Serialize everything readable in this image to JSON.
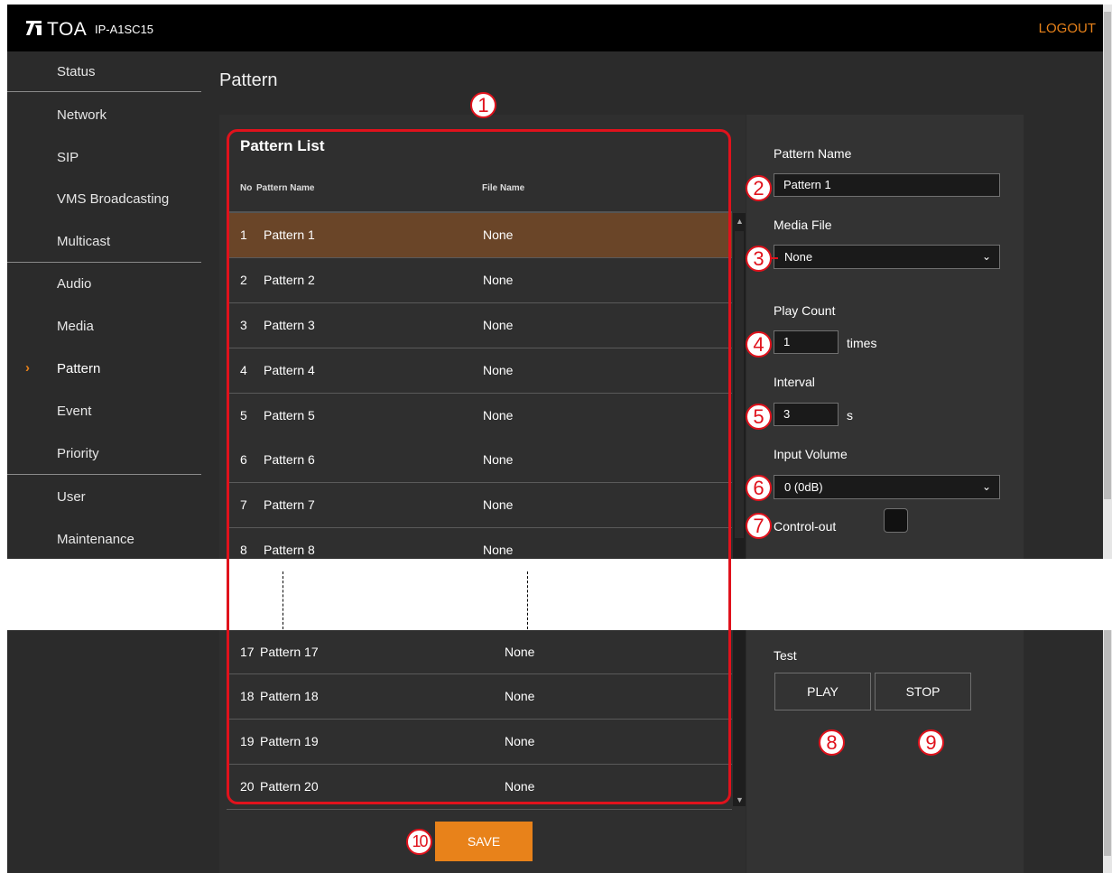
{
  "header": {
    "logo": "TOA",
    "model": "IP-A1SC15",
    "logout_label": "LOGOUT"
  },
  "sidebar": {
    "items": [
      {
        "label": "Status"
      },
      {
        "label": "Network"
      },
      {
        "label": "SIP"
      },
      {
        "label": "VMS Broadcasting"
      },
      {
        "label": "Multicast"
      },
      {
        "label": "Audio"
      },
      {
        "label": "Media"
      },
      {
        "label": "Pattern",
        "active": true
      },
      {
        "label": "Event"
      },
      {
        "label": "Priority"
      },
      {
        "label": "User"
      },
      {
        "label": "Maintenance"
      }
    ],
    "active_marker": "›"
  },
  "page": {
    "title": "Pattern"
  },
  "pattern_list": {
    "heading": "Pattern List",
    "columns": {
      "no": "No",
      "name": "Pattern Name",
      "file": "File Name"
    },
    "rows_top": [
      {
        "no": "1",
        "name": "Pattern 1",
        "file": "None",
        "selected": true
      },
      {
        "no": "2",
        "name": "Pattern 2",
        "file": "None"
      },
      {
        "no": "3",
        "name": "Pattern 3",
        "file": "None"
      },
      {
        "no": "4",
        "name": "Pattern 4",
        "file": "None"
      },
      {
        "no": "5",
        "name": "Pattern 5",
        "file": "None"
      },
      {
        "no": "6",
        "name": "Pattern 6",
        "file": "None"
      },
      {
        "no": "7",
        "name": "Pattern 7",
        "file": "None"
      },
      {
        "no": "8",
        "name": "Pattern 8",
        "file": "None"
      }
    ],
    "rows_bottom": [
      {
        "no": "17",
        "name": "Pattern 17",
        "file": "None"
      },
      {
        "no": "18",
        "name": "Pattern 18",
        "file": "None"
      },
      {
        "no": "19",
        "name": "Pattern 19",
        "file": "None"
      },
      {
        "no": "20",
        "name": "Pattern 20",
        "file": "None"
      }
    ]
  },
  "settings": {
    "pattern_name_label": "Pattern Name",
    "pattern_name_value": "Pattern 1",
    "media_file_label": "Media File",
    "media_file_value": "None",
    "play_count_label": "Play Count",
    "play_count_value": "1",
    "play_count_unit": "times",
    "interval_label": "Interval",
    "interval_value": "3",
    "interval_unit": "s",
    "input_volume_label": "Input Volume",
    "input_volume_value": "0 (0dB)",
    "control_out_label": "Control-out",
    "control_out_checked": false,
    "test_label": "Test",
    "play_label": "PLAY",
    "stop_label": "STOP"
  },
  "save_label": "SAVE",
  "callouts": [
    "1",
    "2",
    "3",
    "4",
    "5",
    "6",
    "7",
    "8",
    "9",
    "10"
  ],
  "colors": {
    "accent": "#e8821a",
    "selected_row": "#6a4528",
    "callout": "#e0121c",
    "topbar": "#000000",
    "background": "#2b2b2b"
  }
}
